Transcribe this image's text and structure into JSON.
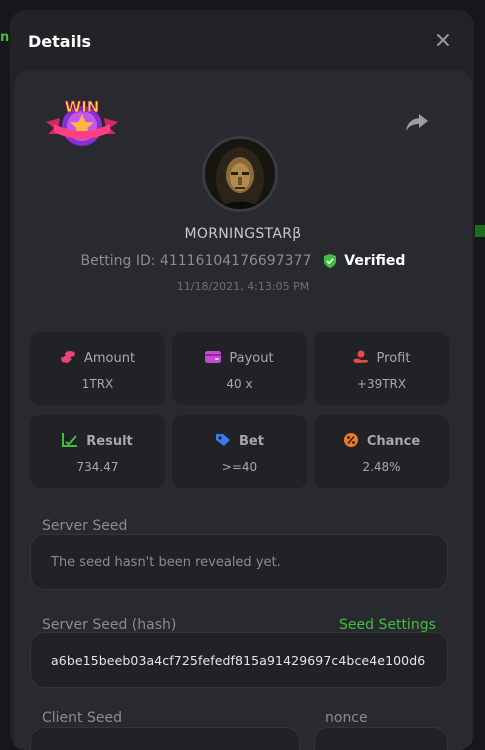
{
  "modal": {
    "title": "Details"
  },
  "background": {
    "left_text": "nk"
  },
  "profile": {
    "badge_text": "WIN",
    "username": "MORNINGSTARβ",
    "betting_id_label": "Betting ID:",
    "betting_id": "41116104176697377",
    "verified_label": "Verified",
    "timestamp": "11/18/2021, 4:13:05 PM"
  },
  "stats": [
    {
      "label": "Amount",
      "value": "1TRX",
      "icon": "coins-icon",
      "color": "#e8467a"
    },
    {
      "label": "Payout",
      "value": "40 x",
      "icon": "wallet-icon",
      "color": "#c24ad6"
    },
    {
      "label": "Profit",
      "value": "+39TRX",
      "icon": "hand-coin-icon",
      "color": "#e84a4a"
    },
    {
      "label": "Result",
      "value": "734.47",
      "icon": "chart-check-icon",
      "color": "#3fbf3f"
    },
    {
      "label": "Bet",
      "value": ">=40",
      "icon": "tag-icon",
      "color": "#3a7bf0"
    },
    {
      "label": "Chance",
      "value": "2.48%",
      "icon": "percent-icon",
      "color": "#f07a2a"
    }
  ],
  "seeds": {
    "server_seed_label": "Server Seed",
    "server_seed_value": "The seed hasn't been revealed yet.",
    "server_seed_hash_label": "Server Seed (hash)",
    "seed_settings_label": "Seed Settings",
    "server_seed_hash_value": "a6be15beeb03a4cf725fefedf815a91429697c4bce4e100d6",
    "client_seed_label": "Client Seed",
    "nonce_label": "nonce"
  },
  "colors": {
    "accent_green": "#3fbf3f",
    "modal_bg": "#222327",
    "panel_bg": "#292a2f"
  }
}
